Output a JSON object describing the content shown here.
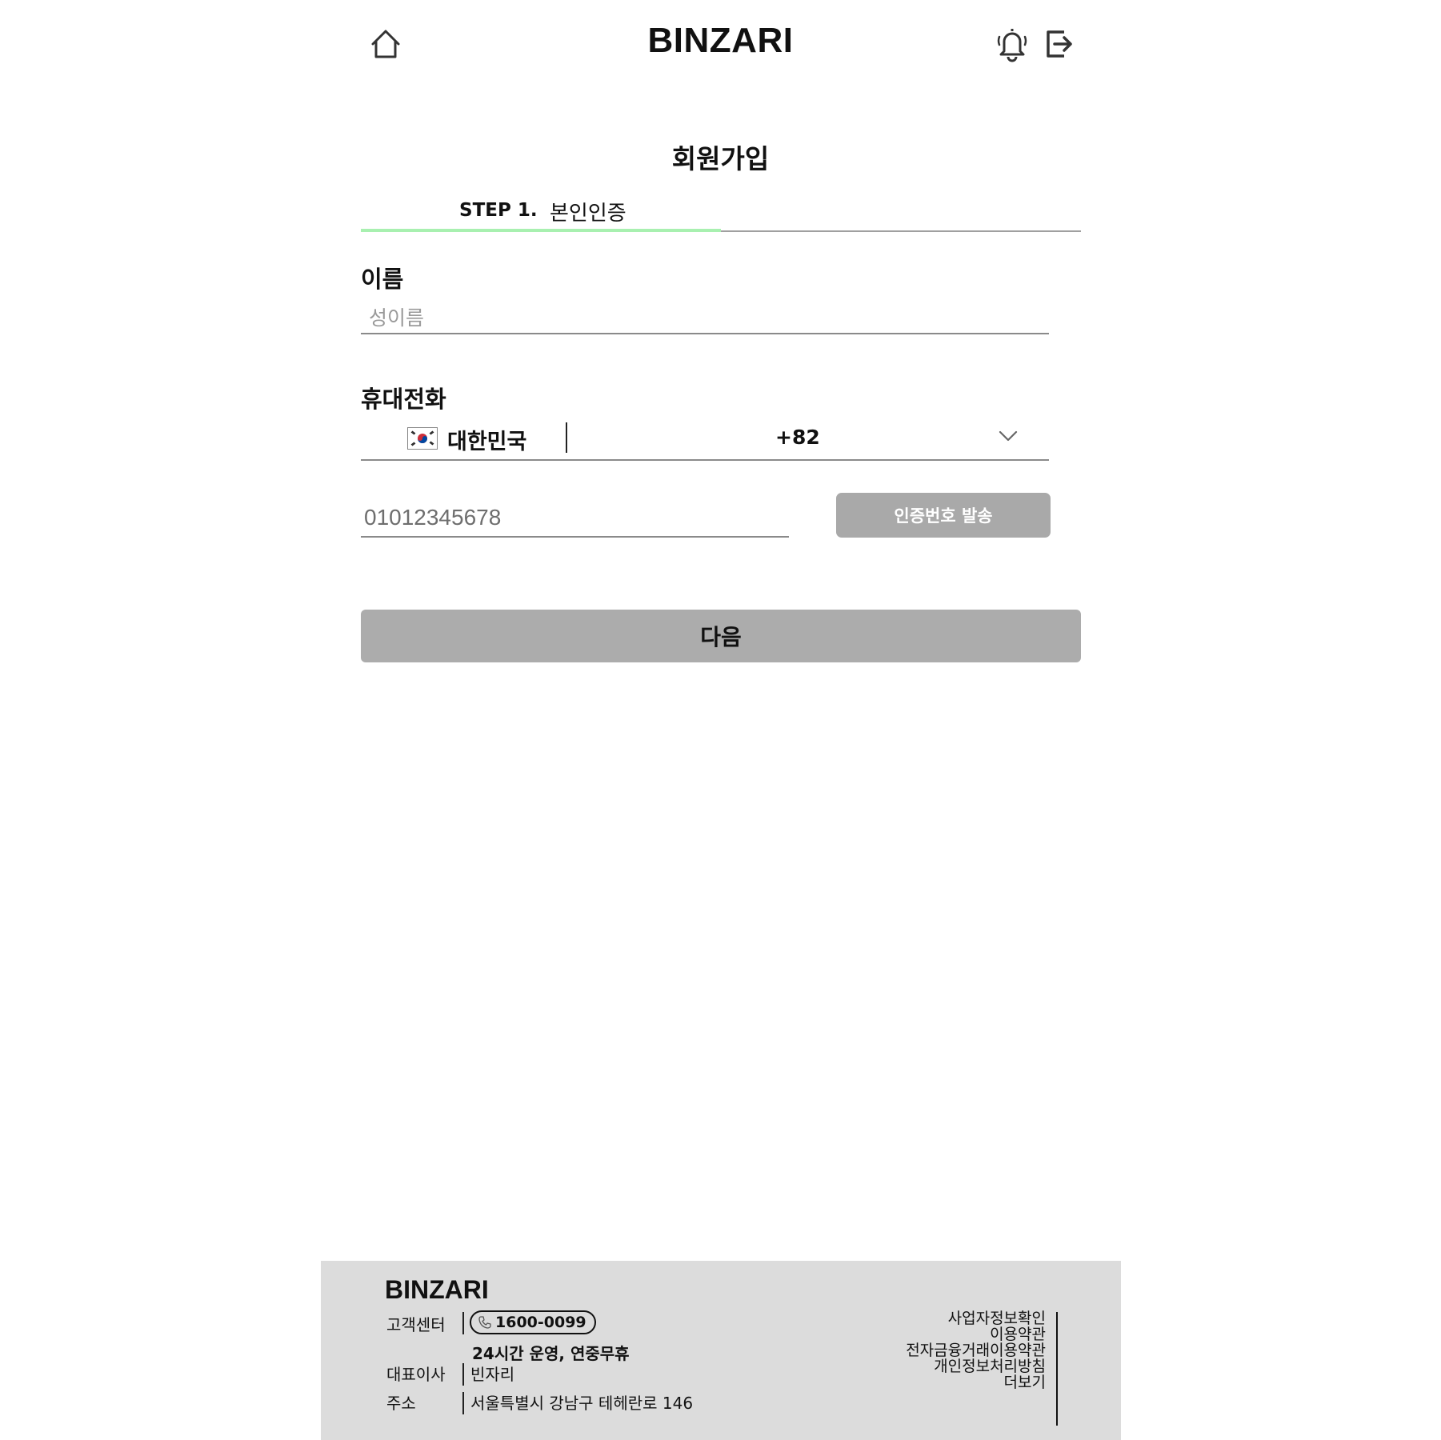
{
  "header": {
    "brand": "BINZARI",
    "icons": [
      "home-icon",
      "bell-icon",
      "logout-icon"
    ]
  },
  "page": {
    "title": "회원가입"
  },
  "step": {
    "label": "STEP 1.",
    "name": "본인인증",
    "accent_color": "#a8f0b0"
  },
  "name_field": {
    "label": "이름",
    "placeholder": "성이름"
  },
  "phone_field": {
    "label": "휴대전화",
    "country": "대한민국",
    "dial_code": "+82",
    "placeholder": "01012345678",
    "send_code_label": "인증번호 발송"
  },
  "next_button": {
    "label": "다음",
    "color": "#acacac"
  },
  "footer": {
    "brand": "BINZARI",
    "customer_center_label": "고객센터",
    "phone": "1600-0099",
    "hours": "24시간 운영, 연중무휴",
    "ceo_label": "대표이사",
    "ceo_value": "빈자리",
    "address_label": "주소",
    "address_value": "서울특별시 강남구 테헤란로 146",
    "links": [
      "사업자정보확인",
      "이용약관",
      "전자금융거래이용약관",
      "개인정보처리방침",
      "더보기"
    ],
    "background": "#dcdcdc"
  }
}
